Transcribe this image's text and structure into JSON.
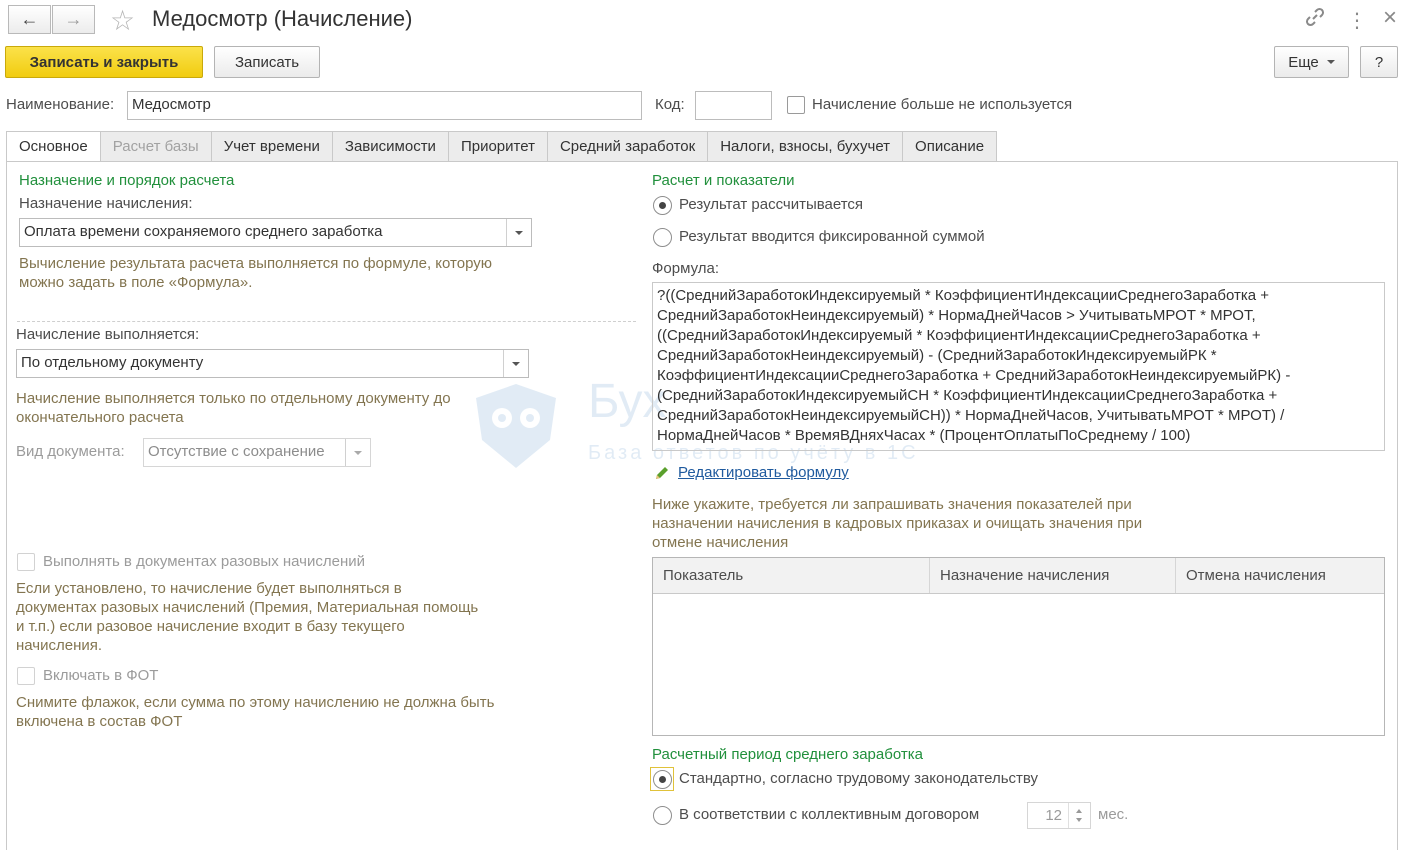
{
  "window": {
    "title": "Медосмотр (Начисление)",
    "back_icon": "←",
    "forward_icon": "→",
    "star_icon": "☆",
    "link_icon": "🔗",
    "menu_icon": "⋮",
    "close_icon": "×"
  },
  "toolbar": {
    "save_close_label": "Записать и закрыть",
    "save_label": "Записать",
    "more_label": "Еще",
    "help_label": "?"
  },
  "header": {
    "name_label": "Наименование:",
    "name_value": "Медосмотр",
    "code_label": "Код:",
    "code_value": "",
    "unused_label": "Начисление больше не используется"
  },
  "tabs": [
    {
      "label": "Основное"
    },
    {
      "label": "Расчет базы"
    },
    {
      "label": "Учет времени"
    },
    {
      "label": "Зависимости"
    },
    {
      "label": "Приоритет"
    },
    {
      "label": "Средний заработок"
    },
    {
      "label": "Налоги, взносы, бухучет"
    },
    {
      "label": "Описание"
    }
  ],
  "left": {
    "section_title": "Назначение и порядок расчета",
    "purpose_label": "Назначение начисления:",
    "purpose_value": "Оплата времени сохраняемого среднего заработка",
    "purpose_hint": "Вычисление результата расчета выполняется по формуле, которую можно задать в поле «Формула».",
    "performed_label": "Начисление выполняется:",
    "performed_value": "По отдельному документу",
    "performed_hint": "Начисление выполняется только по отдельному документу до окончательного расчета",
    "doc_type_label": "Вид документа:",
    "doc_type_value": "Отсутствие с сохранение",
    "one_time_label": "Выполнять в документах разовых начислений",
    "one_time_hint": "Если установлено, то начисление будет выполняться в документах разовых начислений (Премия, Материальная помощь и т.п.) если разовое начисление входит в базу текущего начисления.",
    "fot_label": "Включать в ФОТ",
    "fot_hint": "Снимите флажок, если сумма по этому начислению не должна быть включена в состав ФОТ"
  },
  "right": {
    "section_title": "Расчет и показатели",
    "radio_calc": "Результат рассчитывается",
    "radio_fixed": "Результат вводится фиксированной суммой",
    "formula_label": "Формула:",
    "formula_text": "?((СреднийЗаработокИндексируемый * КоэффициентИндексацииСреднегоЗаработка + СреднийЗаработокНеиндексируемый) * НормаДнейЧасов > УчитыватьМРОТ * МРОТ, ((СреднийЗаработокИндексируемый * КоэффициентИндексацииСреднегоЗаработка + СреднийЗаработокНеиндексируемый) - (СреднийЗаработокИндексируемыйРК * КоэффициентИндексацииСреднегоЗаработка + СреднийЗаработокНеиндексируемыйРК) - (СреднийЗаработокИндексируемыйСН * КоэффициентИндексацииСреднегоЗаработка + СреднийЗаработокНеиндексируемыйСН)) * НормаДнейЧасов, УчитыватьМРОТ * МРОТ) / НормаДнейЧасов * ВремяВДняхЧасах * (ПроцентОплатыПоСреднему / 100)",
    "edit_formula_link": "Редактировать формулу",
    "indicators_hint": "Ниже укажите, требуется ли запрашивать значения показателей при назначении начисления в кадровых приказах и очищать значения при отмене начисления",
    "table_headers": [
      "Показатель",
      "Назначение начисления",
      "Отмена начисления"
    ],
    "period_title": "Расчетный период среднего заработка",
    "radio_standard": "Стандартно, согласно трудовому законодательству",
    "radio_collective": "В соответствии с коллективным договором",
    "months_value": "12",
    "months_unit": "мес."
  },
  "watermark": {
    "big": "Бух",
    "small": "База ответов по учёту в 1С"
  }
}
